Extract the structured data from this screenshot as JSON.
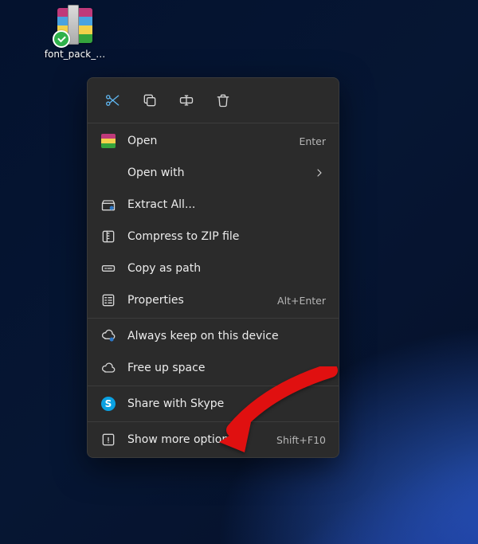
{
  "desktop": {
    "file_label": "font_pack_…"
  },
  "context_menu": {
    "quick_actions": {
      "cut": "Cut",
      "copy": "Copy",
      "rename": "Rename",
      "delete": "Delete"
    },
    "items": {
      "open": "Open",
      "open_accel": "Enter",
      "open_with": "Open with",
      "extract_all": "Extract All...",
      "compress": "Compress to ZIP file",
      "copy_as_path": "Copy as path",
      "properties": "Properties",
      "properties_accel": "Alt+Enter",
      "always_keep": "Always keep on this device",
      "free_up": "Free up space",
      "share_skype": "Share with Skype",
      "show_more": "Show more options",
      "show_more_accel": "Shift+F10"
    }
  }
}
